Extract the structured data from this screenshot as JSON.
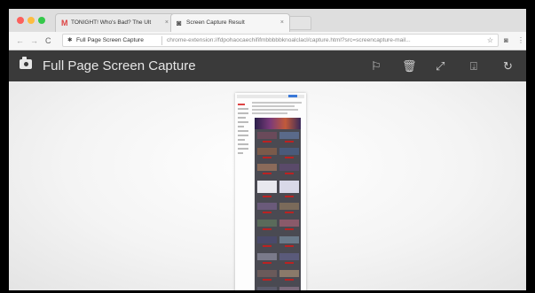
{
  "browser": {
    "tabs": [
      {
        "label": "TONIGHT! Who's Bad? The Ult",
        "favicon": "gmail-icon",
        "active": false
      },
      {
        "label": "Screen Capture Result",
        "favicon": "camera-icon",
        "active": true
      }
    ],
    "nav": {
      "back": "←",
      "forward": "→",
      "reload": "C"
    },
    "address": {
      "site_name": "Full Page Screen Capture",
      "url": "chrome-extension://fdpohaocaechififmbbbbbknoalclacl/capture.html?src=screencapture-mail...",
      "bookmark_icon": "star-icon"
    }
  },
  "app": {
    "title": "Full Page Screen Capture",
    "header_icons": [
      "camera-icon",
      "flag-icon",
      "trash-icon",
      "expand-icon",
      "download-icon",
      "history-icon"
    ]
  },
  "colors": {
    "header_bg": "#3a3a3a",
    "tab_strip": "#dedede",
    "accent_red": "#b22222"
  }
}
